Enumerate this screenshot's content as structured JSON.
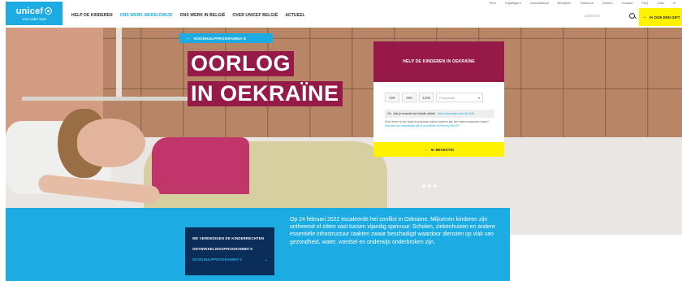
{
  "brand": {
    "logo_word": "unicef",
    "tagline": "voor ieder kind",
    "blue": "#1cabe2",
    "maroon": "#961a48",
    "yellow": "#fff200",
    "navy": "#0b2d5a"
  },
  "utility_nav": {
    "items": [
      "Pers",
      "Vrijwilligers",
      "Lesmateriaal",
      "Bedrijven",
      "Vinkenen",
      "Doelen",
      "Contact",
      "FAQ",
      "Jobs",
      "nl"
    ]
  },
  "main_nav": {
    "items": [
      {
        "label": "HELP DE KINDEREN",
        "active": false
      },
      {
        "label": "ONS WERK WERELDWIJD",
        "active": true
      },
      {
        "label": "ONS WERK IN BELGIË",
        "active": false
      },
      {
        "label": "OVER UNICEF BELGIË",
        "active": false
      },
      {
        "label": "ACTUEEL",
        "active": false
      }
    ]
  },
  "search": {
    "placeholder": "ZOEKEN",
    "icon": "search-icon"
  },
  "donate_header_button": {
    "arrow": "→",
    "label": "IK DOE EEN GIFT"
  },
  "hero": {
    "breadcrumb_arrow": "←",
    "breadcrumb_label": "NOODHULPPROGRAMMA'S",
    "title_line_1": "OORLOG",
    "title_line_2": "IN OEKRAÏNE"
  },
  "donation_card": {
    "heading": "HELP DE KINDEREN IN OEKRAÏNE",
    "amounts": [
      "50€",
      "80€",
      "120€"
    ],
    "frequency_placeholder": "Frequentie",
    "frequency_icon": "chevron-down-icon",
    "notice_prefix": "Ok",
    "notice_text": "Wie je bedankt via Handle officiel",
    "notice_link": "meer informatie over de NAD",
    "info_text": "Wil je liever op een vaste doorlopende manier kinderen aan een helpen kanpunten volgen?",
    "info_link": "Kies dan voor maandelijks gift of word Meter of Peter bij UNICEF.",
    "confirm_arrow": "→",
    "confirm_label": "IK BEVESTIG"
  },
  "side_menu": {
    "items": [
      {
        "label": "WE VERDEDIGEN DE KINDERRECHTEN",
        "active": false
      },
      {
        "label": "ONTWIKKELINGSPROGRAMMA'S",
        "active": false
      },
      {
        "label": "NOODHULPPROGRAMMA'S",
        "active": true
      }
    ],
    "chevron": "⌄"
  },
  "intro": {
    "text": "Op 24 februari 2022 escaleerde het conflict in Oekraïne. Miljoenen kinderen zijn ontheemd of zitten vast tussen vijandig spervuur. Scholen, ziekenhuizen en andere essentiële infrastructuur raakten zwaar beschadigd waardoor diensten op vlak van gezondheid, water, voedsel en onderwijs onderbroken zijn."
  }
}
